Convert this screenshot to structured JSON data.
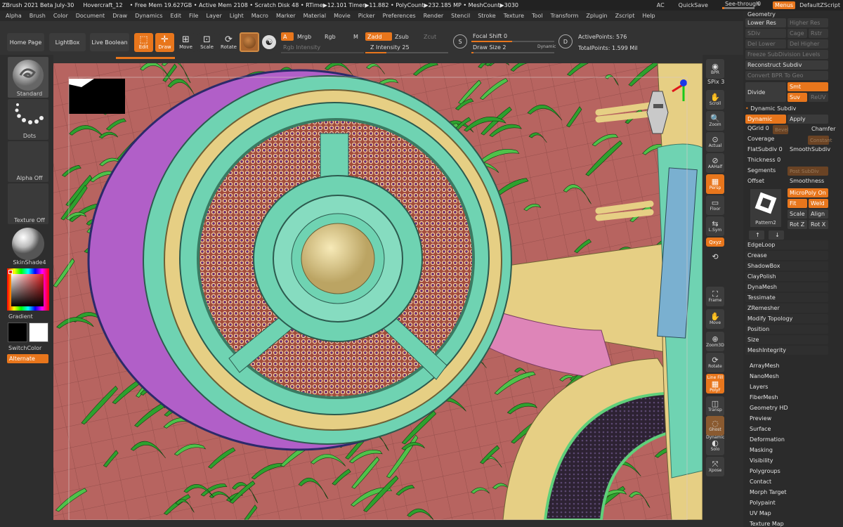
{
  "titlebar": {
    "title": "ZBrush 2021 Beta July-30",
    "project": "Hovercraft_12",
    "stats": "• Free Mem 19.627GB • Active Mem 2108 • Scratch Disk 48 • RTime▶12.101 Timer▶11.882 • PolyCount▶232.185 MP • MeshCount▶3030",
    "ac": "AC",
    "quicksave": "QuickSave",
    "see_through_label": "See-through",
    "see_through_value": "0",
    "see_through_level": 0,
    "menus": "Menus",
    "zscript": "DefaultZScript"
  },
  "menubar": [
    "Alpha",
    "Brush",
    "Color",
    "Document",
    "Draw",
    "Dynamics",
    "Edit",
    "File",
    "Layer",
    "Light",
    "Macro",
    "Marker",
    "Material",
    "Movie",
    "Picker",
    "Preferences",
    "Render",
    "Stencil",
    "Stroke",
    "Texture",
    "Tool",
    "Transform",
    "Zplugin",
    "Zscript",
    "Help"
  ],
  "toolbar": {
    "home": "Home Page",
    "lightbox": "LightBox",
    "live_boolean": "Live Boolean",
    "edit": "Edit",
    "draw": "Draw",
    "move": "Move",
    "scale": "Scale",
    "rotate": "Rotate",
    "a": "A",
    "mrgb": "Mrgb",
    "rgb": "Rgb",
    "m": "M",
    "rgb_intensity": "Rgb Intensity",
    "zadd": "Zadd",
    "zsub": "Zsub",
    "zcut": "Zcut",
    "z_intensity": "Z Intensity 25",
    "z_intensity_value": 25,
    "focal_shift": "Focal Shift 0",
    "draw_size": "Draw Size 2",
    "dynamic": "Dynamic",
    "active_points": "ActivePoints: 576",
    "total_points": "TotalPoints: 1.599 Mil"
  },
  "left": {
    "brush": "Standard",
    "stroke": "Dots",
    "alpha": "Alpha Off",
    "texture": "Texture Off",
    "material": "SkinShade4",
    "gradient": "Gradient",
    "switchcolor": "SwitchColor",
    "alternate": "Alternate"
  },
  "right": {
    "bpr": "BPR",
    "spix": "SPix 3",
    "scroll": "Scroll",
    "zoom": "Zoom",
    "actual": "Actual",
    "aahalf": "AAHalf",
    "persp": "Persp",
    "floor": "Floor",
    "lsym": "L.Sym",
    "xyz": "Qxyz",
    "frame": "Frame",
    "move": "Move",
    "zoom3d": "Zoom3D",
    "rotate": "Rotate",
    "linefill": "Line Fill",
    "polyf": "PolyF",
    "transp": "Transp",
    "ghost": "Ghost",
    "dynamic": "Dynamic",
    "solo": "Solo",
    "xpose": "Xpose"
  },
  "panel": {
    "header": "Geometry",
    "lower_res": "Lower Res",
    "higher_res": "Higher Res",
    "sdiv": "SDiv",
    "cage": "Cage",
    "rstr": "Rstr",
    "del_lower": "Del Lower",
    "del_higher": "Del Higher",
    "freeze": "Freeze SubDivision Levels",
    "reconstruct": "Reconstruct Subdiv",
    "convert": "Convert BPR To Geo",
    "divide": "Divide",
    "smt": "Smt",
    "suv": "Suv",
    "reuv": "ReUV",
    "dynamic_subdiv": "Dynamic Subdiv",
    "dynamic": "Dynamic",
    "apply": "Apply",
    "qgrid": "QGrid 0",
    "bevel": "Bevel",
    "chamfer": "Chamfer",
    "coverage": "Coverage",
    "constant": "Constant",
    "flatsubdiv": "FlatSubdiv 0",
    "smoothsubdiv": "SmoothSubdiv",
    "thickness": "Thickness 0",
    "segments": "Segments",
    "post_subdiv": "Post SubDiv",
    "offset": "Offset",
    "smoothness": "Smoothness",
    "micropoly": "MicroPoly On",
    "fit": "Fit",
    "weld": "Weld",
    "scale": "Scale",
    "align": "Align",
    "rotz": "Rot Z",
    "rotx": "Rot X",
    "pattern": "Pattern2",
    "items": [
      "EdgeLoop",
      "Crease",
      "ShadowBox",
      "ClayPolish",
      "DynaMesh",
      "Tessimate",
      "ZRemesher",
      "Modify Topology",
      "Position",
      "Size",
      "MeshIntegrity"
    ],
    "subpalettes": [
      "ArrayMesh",
      "NanoMesh",
      "Layers",
      "FiberMesh",
      "Geometry HD",
      "Preview",
      "Surface",
      "Deformation",
      "Masking",
      "Visibility",
      "Polygroups",
      "Contact",
      "Morph Target",
      "Polypaint",
      "UV Map",
      "Texture Map"
    ]
  },
  "colors": {
    "accent": "#e8761c",
    "mesh_purple": "#b15fc8",
    "mesh_teal": "#6fd3b2",
    "mesh_tan": "#e8d79a",
    "mesh_pink": "#de85b8",
    "grass": "#2ea12e",
    "ground": "#b76460"
  }
}
